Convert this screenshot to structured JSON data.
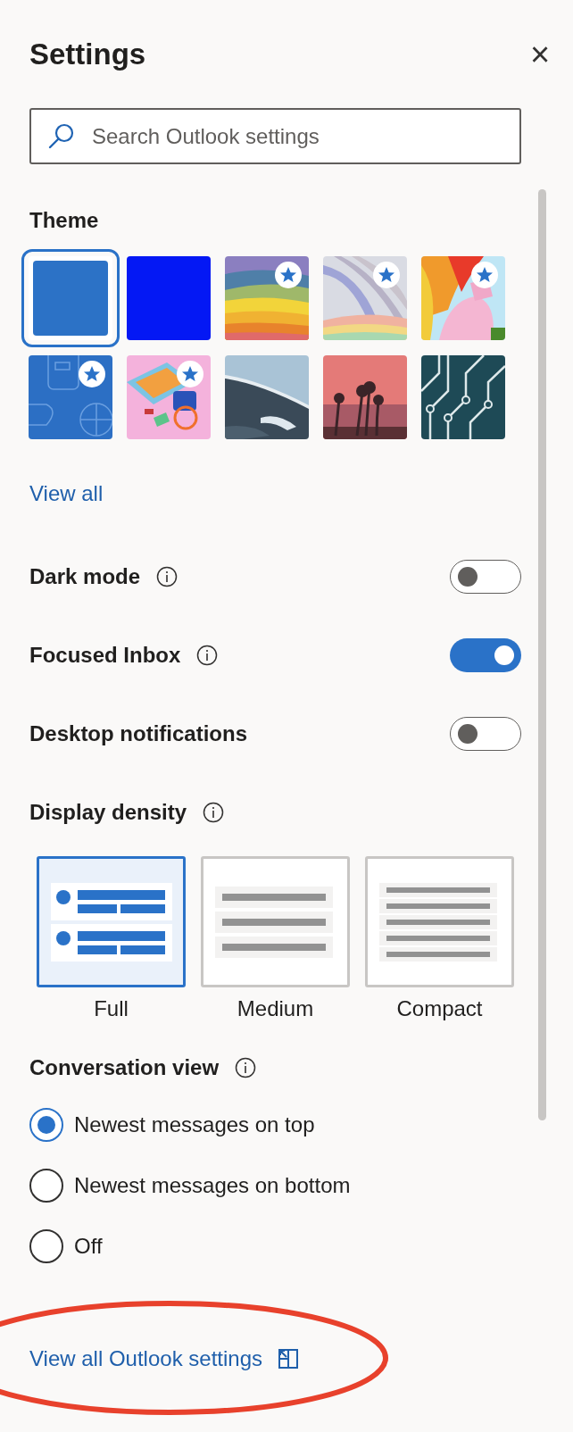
{
  "panel": {
    "title": "Settings",
    "close": "×"
  },
  "search": {
    "placeholder": "Search Outlook settings"
  },
  "theme": {
    "label": "Theme",
    "swatches": [
      {
        "kind": "color",
        "color": "#2c72c6",
        "selected": true,
        "premium": false
      },
      {
        "kind": "color",
        "color": "#0418f4",
        "selected": false,
        "premium": false
      },
      {
        "kind": "picture",
        "selected": false,
        "premium": true
      },
      {
        "kind": "picture",
        "selected": false,
        "premium": true
      },
      {
        "kind": "picture",
        "selected": false,
        "premium": true
      },
      {
        "kind": "picture",
        "selected": false,
        "premium": true
      },
      {
        "kind": "picture",
        "selected": false,
        "premium": true
      },
      {
        "kind": "picture",
        "selected": false,
        "premium": false
      },
      {
        "kind": "picture",
        "selected": false,
        "premium": false
      },
      {
        "kind": "picture",
        "selected": false,
        "premium": false
      }
    ],
    "link": "View all"
  },
  "toggles": [
    {
      "label": "Dark mode",
      "info": true,
      "on": false
    },
    {
      "label": "Focused Inbox",
      "info": true,
      "on": true
    },
    {
      "label": "Desktop notifications",
      "info": false,
      "on": false
    }
  ],
  "density": {
    "label": "Display density",
    "info": true,
    "options": [
      {
        "kind": "full",
        "label": "Full",
        "selected": true
      },
      {
        "kind": "medium",
        "label": "Medium",
        "selected": false
      },
      {
        "kind": "compact",
        "label": "Compact",
        "selected": false
      }
    ]
  },
  "conversation": {
    "label": "Conversation view",
    "info": true,
    "options": [
      {
        "label": "Newest messages on top",
        "selected": true
      },
      {
        "label": "Newest messages on bottom",
        "selected": false
      },
      {
        "label": "Off",
        "selected": false
      }
    ]
  },
  "footer_link": "View all Outlook settings"
}
